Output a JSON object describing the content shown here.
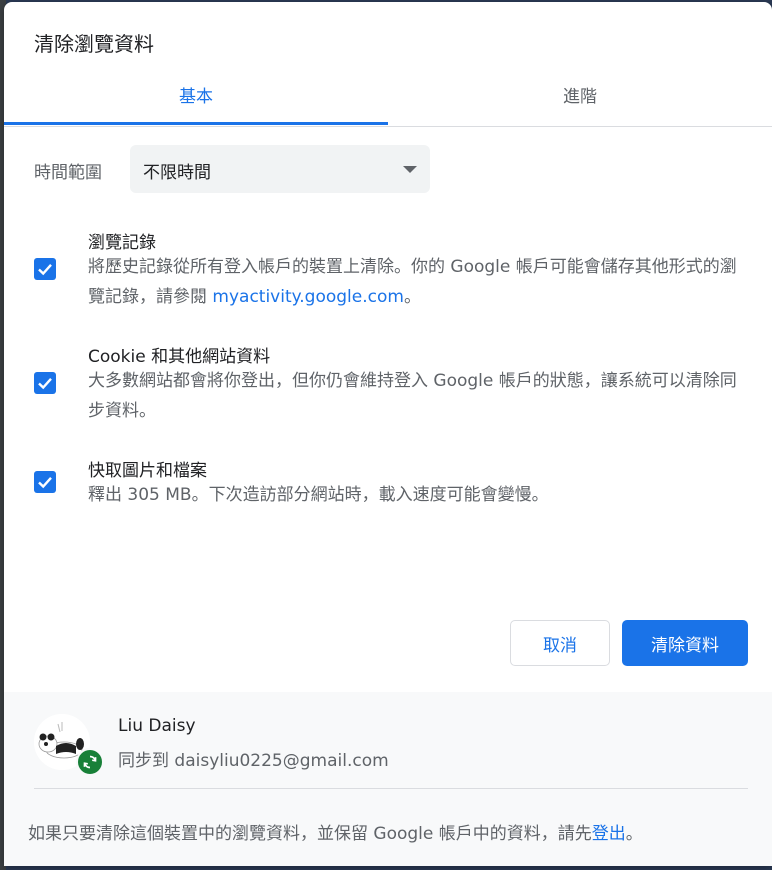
{
  "dialog": {
    "title": "清除瀏覽資料"
  },
  "tabs": [
    {
      "label": "基本",
      "selected": true
    },
    {
      "label": "進階",
      "selected": false
    }
  ],
  "time_range": {
    "label": "時間範圍",
    "value": "不限時間"
  },
  "options": [
    {
      "title": "瀏覽記錄",
      "checked": true,
      "desc_before": "將歷史記錄從所有登入帳戶的裝置上清除。你的 Google 帳戶可能會儲存其他形式的瀏覽記錄，請參閱 ",
      "desc_link": "myactivity.google.com",
      "desc_after": "。"
    },
    {
      "title": "Cookie 和其他網站資料",
      "checked": true,
      "desc": "大多數網站都會將你登出，但你仍會維持登入 Google 帳戶的狀態，讓系統可以清除同步資料。"
    },
    {
      "title": "快取圖片和檔案",
      "checked": true,
      "desc": "釋出 305 MB。下次造訪部分網站時，載入速度可能會變慢。"
    }
  ],
  "buttons": {
    "cancel": "取消",
    "clear": "清除資料"
  },
  "account": {
    "name": "Liu Daisy",
    "sync_text": "同步到 daisyliu0225@gmail.com"
  },
  "footer_note": {
    "text": "如果只要清除這個裝置中的瀏覽資料，並保留 Google 帳戶中的資料，請先",
    "link": "登出",
    "end": "。"
  },
  "colors": {
    "accent": "#1a73e8",
    "sync_badge": "#188038"
  }
}
